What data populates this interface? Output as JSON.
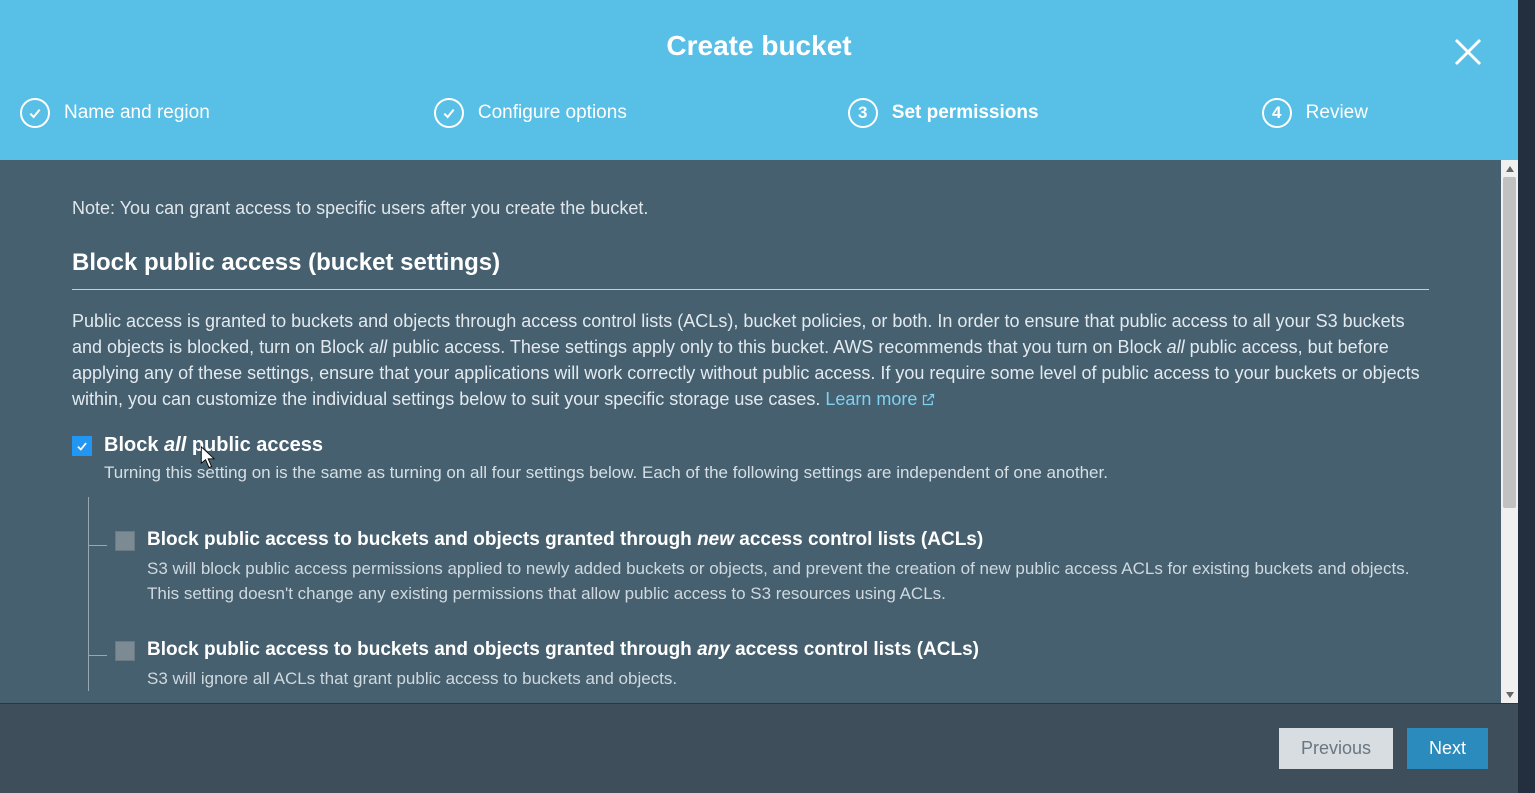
{
  "title": "Create bucket",
  "steps": {
    "s1": "Name and region",
    "s2": "Configure options",
    "s3_num": "3",
    "s3": "Set permissions",
    "s4_num": "4",
    "s4": "Review"
  },
  "note": "Note: You can grant access to specific users after you create the bucket.",
  "section_title": "Block public access (bucket settings)",
  "desc_p1": "Public access is granted to buckets and objects through access control lists (ACLs), bucket policies, or both. In order to ensure that public access to all your S3 buckets and objects is blocked, turn on Block ",
  "desc_all1": "all",
  "desc_p2": " public access. These settings apply only to this bucket. AWS recommends that you turn on Block ",
  "desc_all2": "all",
  "desc_p3": " public access, but before applying any of these settings, ensure that your applications will work correctly without public access. If you require some level of public access to your buckets or objects within, you can customize the individual settings below to suit your specific storage use cases. ",
  "learn_more": "Learn more",
  "main_check": {
    "pre": "Block ",
    "ital": "all",
    "post": " public access",
    "helper": "Turning this setting on is the same as turning on all four settings below. Each of the following settings are independent of one another."
  },
  "sub1": {
    "pre": "Block public access to buckets and objects granted through ",
    "ital": "new",
    "post": " access control lists (ACLs)",
    "helper": "S3 will block public access permissions applied to newly added buckets or objects, and prevent the creation of new public access ACLs for existing buckets and objects. This setting doesn't change any existing permissions that allow public access to S3 resources using ACLs."
  },
  "sub2": {
    "pre": "Block public access to buckets and objects granted through ",
    "ital": "any",
    "post": " access control lists (ACLs)",
    "helper": "S3 will ignore all ACLs that grant public access to buckets and objects."
  },
  "footer": {
    "prev": "Previous",
    "next": "Next"
  }
}
